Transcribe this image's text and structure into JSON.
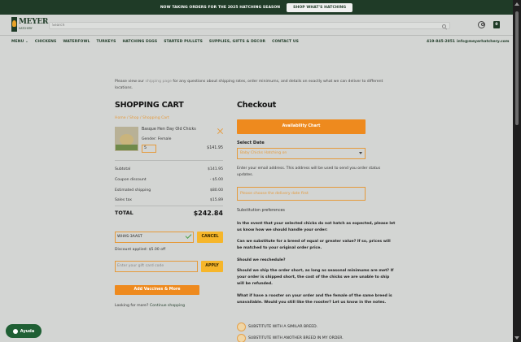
{
  "banner": {
    "text": "NOW TAKING ORDERS FOR THE 2025 HATCHING SEASON",
    "button": "SHOP WHAT'S HATCHING"
  },
  "brand": {
    "name": "MEYER",
    "sub": "HATCHERY"
  },
  "search": {
    "placeholder": "Search"
  },
  "nav": {
    "items": [
      "MENU ⌄",
      "CHICKENS",
      "WATERFOWL",
      "TURKEYS",
      "HATCHING EGGS",
      "STARTED PULLETS",
      "SUPPLIES, GIFTS & DECOR",
      "CONTACT US"
    ],
    "phone": "419-845-2851",
    "email": "info@meyerhatchery.com"
  },
  "notice": {
    "before": "Please view our ",
    "link": "shipping page",
    "after": " for any questions about shipping rates, order minimums, and details on exactly what we can deliver to different locations."
  },
  "cart": {
    "title": "SHOPPING CART",
    "breadcrumb": "Home  /  Shop  /  Shopping Cart",
    "product": {
      "name": "Basque Hen Day Old Chicks",
      "gender": "Gender: Female",
      "qty": "5",
      "price": "$141.95"
    },
    "summary": [
      {
        "label": "Subtotal",
        "value": "$141.95"
      },
      {
        "label": "Coupon discount",
        "value": "- $5.00"
      },
      {
        "label": "Estimated shipping",
        "value": "$80.00"
      },
      {
        "label": "Sales tax",
        "value": "$15.89"
      }
    ],
    "total": {
      "label": "TOTAL",
      "value": "$242.84"
    },
    "coupon": {
      "value": "WHAS-3AAST",
      "cancel": "CANCEL",
      "applied": "Discount applied: $5.00 off"
    },
    "gift": {
      "placeholder": "Enter your gift card code",
      "apply": "APPLY"
    },
    "add_vaccines": "Add Vaccines & More",
    "looking": {
      "before": "Looking for more? ",
      "link": "Continue shopping"
    }
  },
  "checkout": {
    "title": "Checkout",
    "availability_button": "Availability Chart",
    "select_date_label": "Select Date",
    "date_select": "Baby Chicks Hatching on",
    "email_note": "Enter your email address. This address will be used to send you order status updates.",
    "delivery_select": "Please choose the delivery date first",
    "sub_prefs": "Substitution preferences",
    "q1": "In the event that your selected chicks do not hatch as expected, please let us know how we should handle your order:",
    "q2": "Can we substitute for a breed of equal or greater value? If so, prices will be matched to your original order price.",
    "q3": "Should we reschedule?",
    "q4": "Should we ship the order short, as long as seasonal minimums are met? If your order is shipped short, the cost of the chicks we are unable to ship will be refunded.",
    "q5": "What if have a rooster on your order and the female of the same breed is unavailable. Would you still like the rooster? Let us know in the notes.",
    "radio1": "SUBSTITUTE WITH A SIMILAR BREED.",
    "radio2": "SUBSTITUTE WITH ANOTHER BREED IN MY ORDER."
  },
  "help": {
    "label": "Ayuda"
  },
  "colors": {
    "brand_green": "#1f3b27",
    "accent_orange": "#ee8a1e",
    "accent_yellow": "#f6b62a",
    "background": "#d3d5d3"
  },
  "icons": [
    "search-icon",
    "account-icon",
    "cart-icon",
    "remove-icon",
    "check-icon",
    "chevron-down-icon",
    "chat-icon"
  ]
}
